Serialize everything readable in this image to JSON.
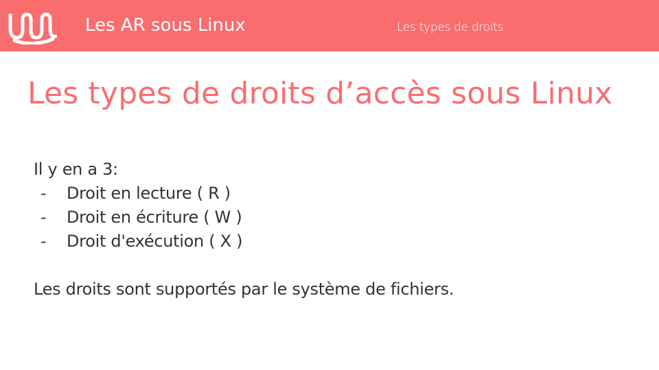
{
  "header": {
    "title": "Les AR sous Linux",
    "section": "Les types de droits",
    "logo_icon": "wave-logo-icon",
    "color": "#f96d6f"
  },
  "slide": {
    "title": "Les types de droits d’accès sous Linux",
    "intro": "Il y en a 3:",
    "rights": [
      "Droit en lecture ( R )",
      "Droit en écriture ( W )",
      "Droit d'exécution ( X )"
    ],
    "bullet_marker": "-",
    "footnote": "Les droits sont supportés par le système de fichiers."
  },
  "colors": {
    "accent": "#f96d6f",
    "text": "#333333",
    "background": "#ffffff"
  }
}
